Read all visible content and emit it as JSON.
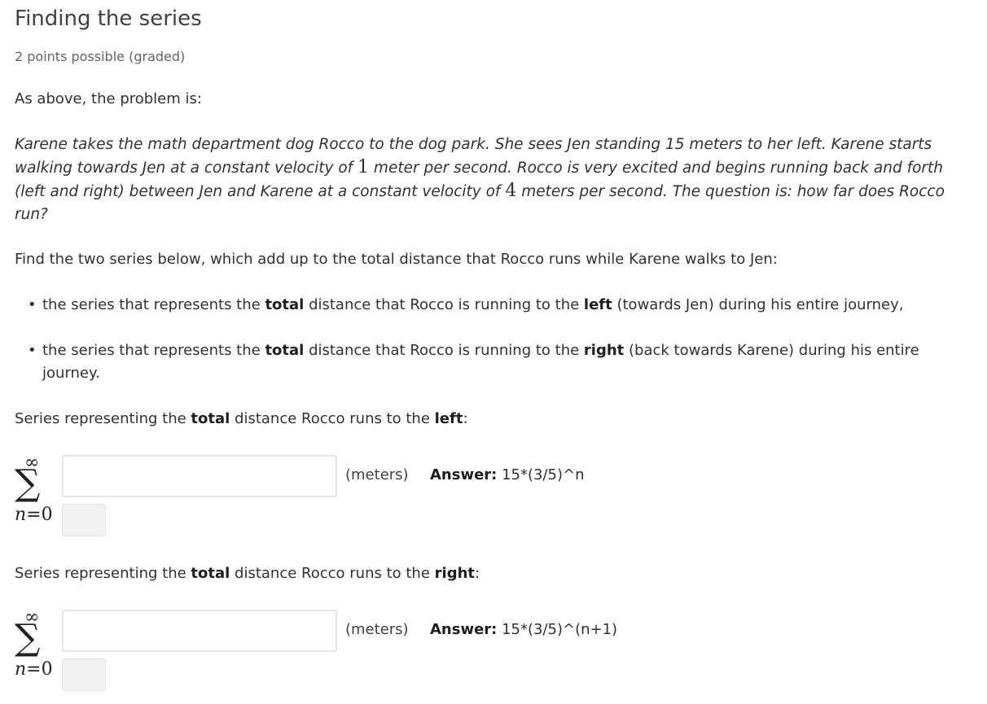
{
  "problem": {
    "title": "Finding the series",
    "points": "2 points possible (graded)",
    "intro": "As above, the problem is:",
    "statement": {
      "part1": "Karene takes the math department dog Rocco to the dog park. She sees Jen standing 15 meters to her left. Karene starts walking towards Jen at a constant velocity of ",
      "v1": "1",
      "part2": " meter per second. Rocco is very excited and begins running back and forth (left and right) between Jen and Karene at a constant velocity of ",
      "v2": "4",
      "part3": " meters per second. The question is: how far does Rocco run?"
    },
    "find_text": "Find the two series below, which add up to the total distance that Rocco runs while Karene walks to Jen:",
    "bullets": [
      {
        "pre": "the series that represents the ",
        "bold1": "total",
        "mid": " distance that Rocco is running to the ",
        "bold2": "left",
        "post": " (towards Jen) during his entire journey,"
      },
      {
        "pre": "the series that represents the ",
        "bold1": "total",
        "mid": " distance that Rocco is running to the ",
        "bold2": "right",
        "post": " (back towards Karene) during his entire journey."
      }
    ],
    "series": [
      {
        "label_pre": "Series representing the ",
        "label_bold1": "total",
        "label_mid": " distance Rocco runs to the ",
        "label_bold2": "left",
        "label_post": ":",
        "upper": "∞",
        "sigma": "∑",
        "lower_var": "n",
        "lower_eq": "=0",
        "input_value": "",
        "unit": "(meters)",
        "answer_label": "Answer:",
        "answer_value": " 15*(3/5)^n"
      },
      {
        "label_pre": "Series representing the ",
        "label_bold1": "total",
        "label_mid": " distance Rocco runs to the ",
        "label_bold2": "right",
        "label_post": ":",
        "upper": "∞",
        "sigma": "∑",
        "lower_var": "n",
        "lower_eq": "=0",
        "input_value": "",
        "unit": "(meters)",
        "answer_label": "Answer:",
        "answer_value": " 15*(3/5)^(n+1)"
      }
    ],
    "bullet_glyph": "•"
  }
}
